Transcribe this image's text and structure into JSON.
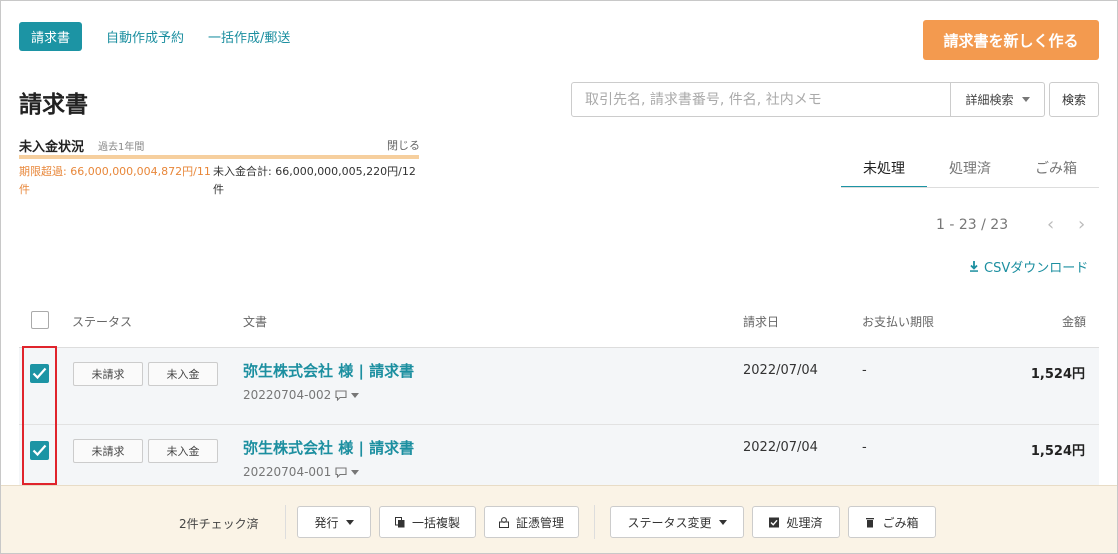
{
  "nav": {
    "invoices_tab": "請求書",
    "auto_schedule": "自動作成予約",
    "bulk_create": "一括作成/郵送",
    "create_button": "請求書を新しく作る"
  },
  "page": {
    "title": "請求書"
  },
  "search": {
    "placeholder": "取引先名, 請求書番号, 件名, 社内メモ",
    "value": "",
    "detail_label": "詳細検索",
    "search_button": "検索"
  },
  "unpaid": {
    "title": "未入金状況",
    "period": "過去1年間",
    "close": "閉じる",
    "overdue": "期限超過: 66,000,000,004,872円/11件",
    "total": "未入金合計: 66,000,000,005,220円/12件"
  },
  "tabs": {
    "unprocessed": "未処理",
    "processed": "処理済",
    "trash": "ごみ箱",
    "active": "未処理"
  },
  "pagination": {
    "text": "1 - 23 / 23",
    "prev": "‹",
    "next": "›"
  },
  "csv": {
    "label": "CSVダウンロード"
  },
  "table": {
    "columns": {
      "status": "ステータス",
      "document": "文書",
      "date": "請求日",
      "due": "お支払い期限",
      "amount": "金額"
    },
    "rows": [
      {
        "checked": true,
        "tag1": "未請求",
        "tag2": "未入金",
        "title": "弥生株式会社 様 | 請求書",
        "number": "20220704-002",
        "date": "2022/07/04",
        "due": "-",
        "amount": "1,524円"
      },
      {
        "checked": true,
        "tag1": "未請求",
        "tag2": "未入金",
        "title": "弥生株式会社 様 | 請求書",
        "number": "20220704-001",
        "date": "2022/07/04",
        "due": "-",
        "amount": "1,524円"
      }
    ]
  },
  "actions": {
    "checked_count": "2件チェック済",
    "issue": "発行",
    "bulk_copy": "一括複製",
    "evidence": "証憑管理",
    "status_change": "ステータス変更",
    "processed": "処理済",
    "trash": "ごみ箱"
  },
  "colors": {
    "accent": "#1c94a4",
    "create_button": "#f39a4f",
    "overdue_text": "#e8873a",
    "highlight": "#e0242c"
  }
}
